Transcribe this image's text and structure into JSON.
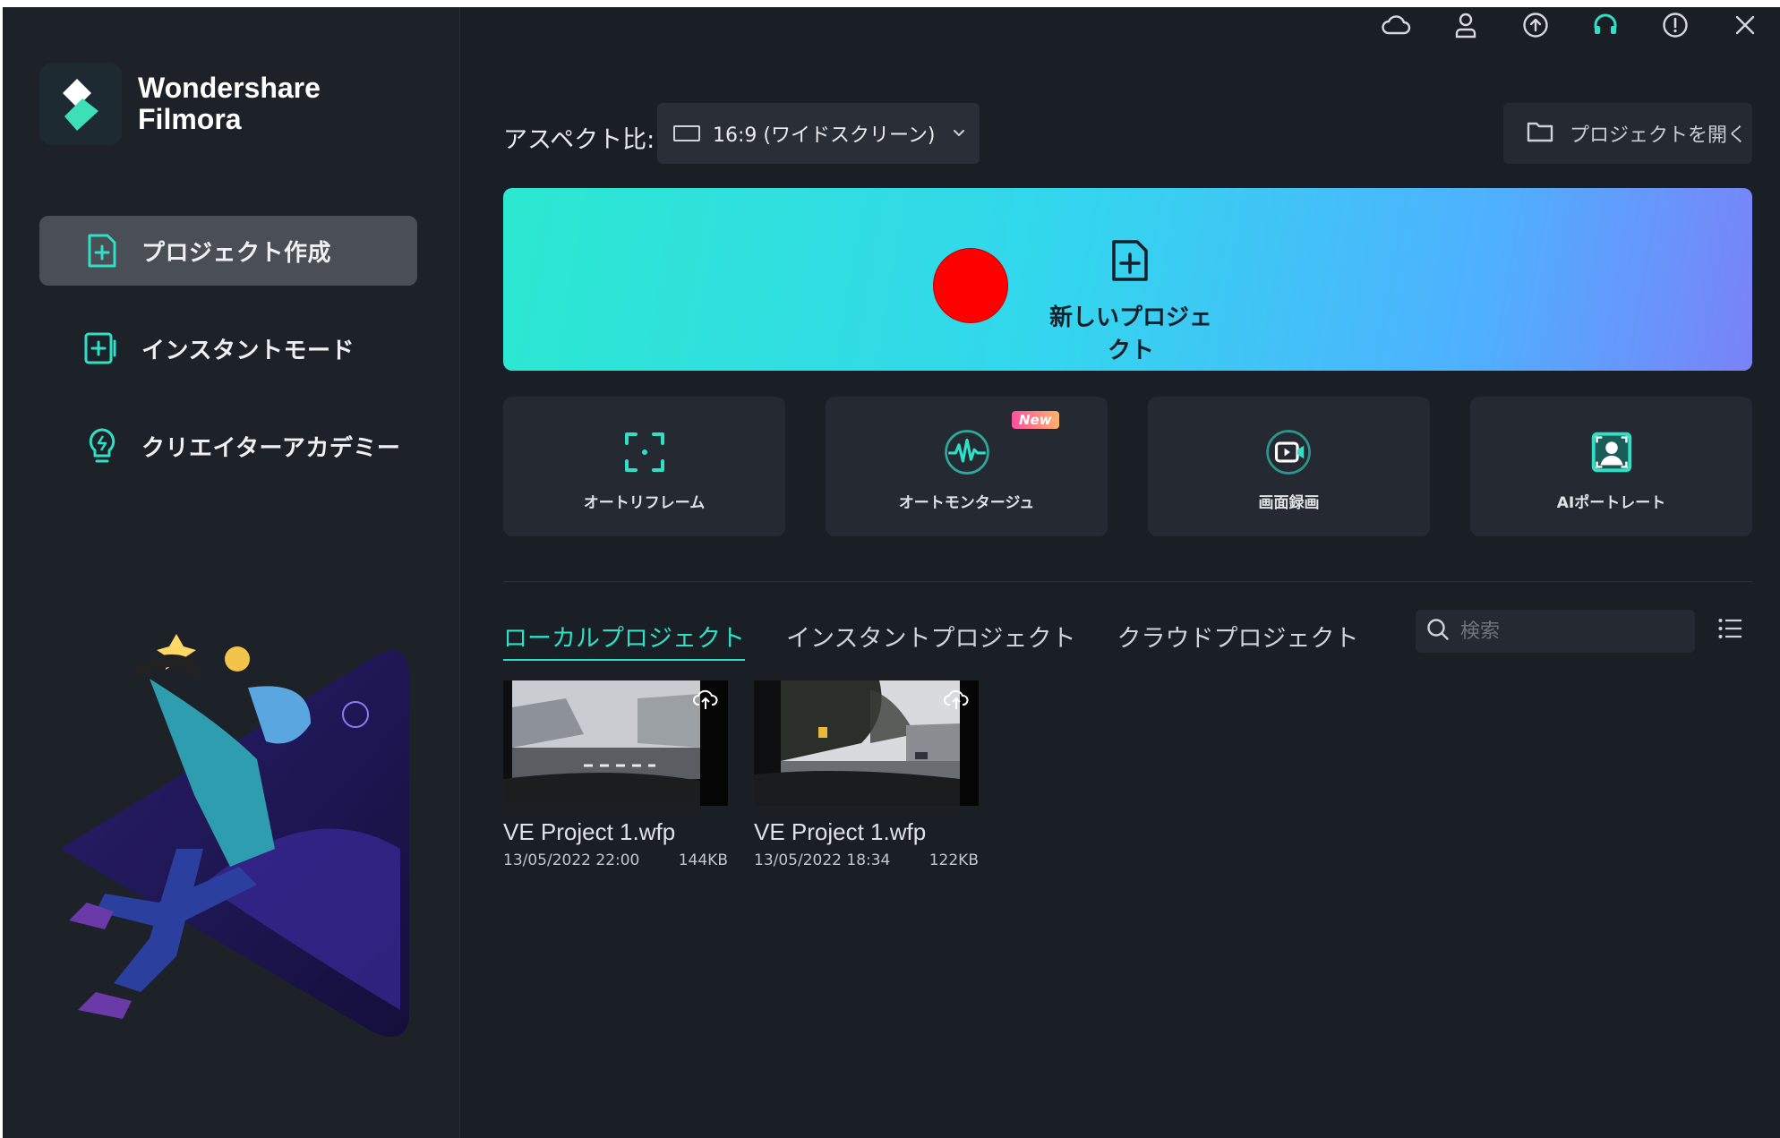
{
  "app": {
    "brand_line1": "Wondershare",
    "brand_line2": "Filmora"
  },
  "sidebar": {
    "items": [
      {
        "label": "プロジェクト作成",
        "icon": "new-project-icon",
        "active": true
      },
      {
        "label": "インスタントモード",
        "icon": "instant-mode-icon",
        "active": false
      },
      {
        "label": "クリエイターアカデミー",
        "icon": "lightbulb-icon",
        "active": false
      }
    ]
  },
  "topbar": {
    "icons": [
      "cloud-icon",
      "account-icon",
      "upload-icon",
      "support-headset-icon",
      "info-icon",
      "close-icon"
    ]
  },
  "aspect": {
    "label": "アスペクト比:",
    "value": "16:9 (ワイドスクリーン)"
  },
  "open_project": {
    "label": "プロジェクトを開く"
  },
  "new_project": {
    "label": "新しいプロジェクト"
  },
  "tools": [
    {
      "label": "オートリフレーム",
      "icon": "auto-reframe-icon",
      "badge": ""
    },
    {
      "label": "オートモンタージュ",
      "icon": "auto-montage-icon",
      "badge": "New"
    },
    {
      "label": "画面録画",
      "icon": "screen-record-icon",
      "badge": ""
    },
    {
      "label": "AIポートレート",
      "icon": "ai-portrait-icon",
      "badge": ""
    }
  ],
  "project_tabs": [
    {
      "label": "ローカルプロジェクト",
      "active": true
    },
    {
      "label": "インスタントプロジェクト",
      "active": false
    },
    {
      "label": "クラウドプロジェクト",
      "active": false
    }
  ],
  "search": {
    "placeholder": "検索",
    "value": ""
  },
  "projects": [
    {
      "name": "VE Project 1.wfp",
      "date": "13/05/2022 22:00",
      "size": "144KB"
    },
    {
      "name": "VE Project 1.wfp",
      "date": "13/05/2022 18:34",
      "size": "122KB"
    }
  ],
  "colors": {
    "accent": "#2fe0c6",
    "background": "#1a1e25",
    "sidebar": "#1d2128",
    "marker": "#ff0000"
  }
}
